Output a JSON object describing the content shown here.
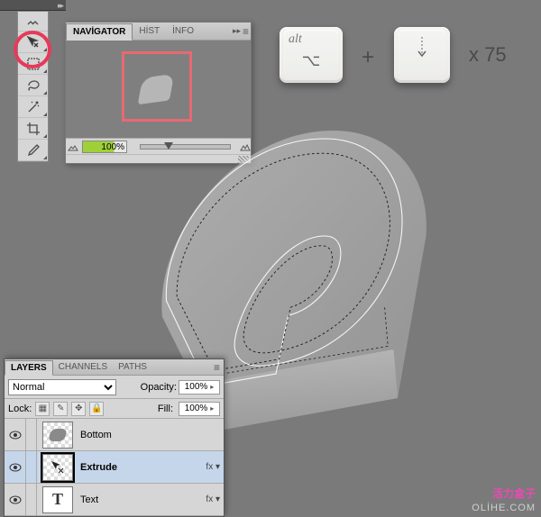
{
  "toolstrip": {
    "tools": [
      "expand-icon",
      "move-tool-icon",
      "marquee-icon",
      "lasso-icon",
      "wand-icon",
      "crop-icon",
      "eyedropper-icon"
    ]
  },
  "navigator": {
    "tabs": [
      "NAVİGATOR",
      "HİST",
      "İNFO"
    ],
    "active_tab": 0,
    "zoom": "100%"
  },
  "keys": {
    "alt_label": "alt",
    "alt_symbol": "⌥",
    "down_symbol": "↓",
    "plus": "+",
    "times_prefix": "x",
    "times_value": "75"
  },
  "layers": {
    "tabs": [
      "LAYERS",
      "CHANNELS",
      "PATHS"
    ],
    "active_tab": 0,
    "blend_mode": "Normal",
    "opacity_label": "Opacity:",
    "opacity_value": "100%",
    "lock_label": "Lock:",
    "fill_label": "Fill:",
    "fill_value": "100%",
    "rows": [
      {
        "name": "Bottom",
        "visible": true,
        "selected": false,
        "thumb": "shape",
        "fx": ""
      },
      {
        "name": "Extrude",
        "visible": true,
        "selected": true,
        "thumb": "cursor",
        "fx": "fx ▾"
      },
      {
        "name": "Text",
        "visible": true,
        "selected": false,
        "thumb": "T",
        "fx": "fx ▾"
      }
    ]
  },
  "watermark": {
    "cn": "活力盒子",
    "en": "OLİHE.COM"
  }
}
